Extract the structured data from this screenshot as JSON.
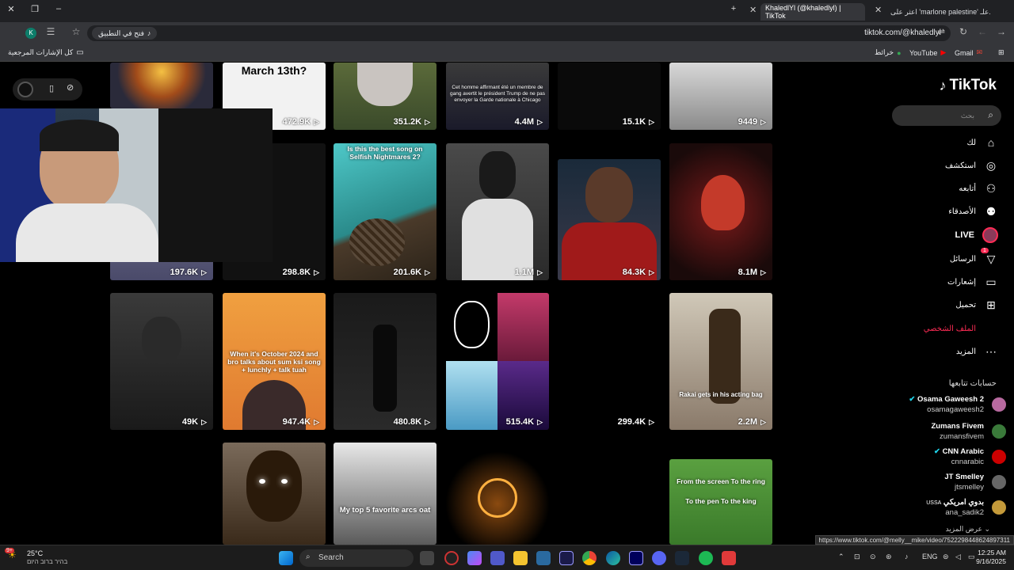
{
  "browser": {
    "tabs": [
      {
        "label": "KhaledlYl (@khaledlyl) | TikTok",
        "active": true
      },
      {
        "label": "اعثر على 'marlone palestine' علـ...",
        "active": false
      }
    ],
    "url": "tiktok.com/@khaledlyl",
    "open_in_app": "فتح في التطبيق",
    "bookmarks": {
      "all_bookmarks": "كل الإشارات المرجعية",
      "gmail": "Gmail",
      "youtube": "YouTube",
      "maps": "خرائط"
    },
    "profile_initial": "K"
  },
  "tiktok": {
    "logo": "TikTok",
    "search_placeholder": "بحث",
    "nav": [
      {
        "label": "لك",
        "icon": "home-icon"
      },
      {
        "label": "استكشف",
        "icon": "compass-icon"
      },
      {
        "label": "أتابعه",
        "icon": "following-icon"
      },
      {
        "label": "الأصدقاء",
        "icon": "friends-icon"
      },
      {
        "label": "LIVE",
        "icon": "live-icon"
      },
      {
        "label": "الرسائل",
        "icon": "send-icon",
        "badge": "1"
      },
      {
        "label": "إشعارات",
        "icon": "inbox-icon"
      },
      {
        "label": "تحميل",
        "icon": "upload-icon"
      },
      {
        "label": "الملف الشخصي",
        "icon": "profile-icon",
        "active": true
      },
      {
        "label": "المزيد",
        "icon": "more-icon"
      }
    ],
    "following_title": "حسابات تتابعها",
    "following": [
      {
        "name": "Osama Gaweesh 2",
        "handle": "osamagaweesh2",
        "verified": true,
        "color": "#b86aa0"
      },
      {
        "name": "Zumans Fivem",
        "handle": "zumansfivem",
        "verified": false,
        "color": "#3a7a3a"
      },
      {
        "name": "CNN Arabic",
        "handle": "cnnarabic",
        "verified": true,
        "color": "#cc0000"
      },
      {
        "name": "JT Smelley",
        "handle": "jtsmelley",
        "verified": false,
        "color": "#666666"
      },
      {
        "name": "بدوي امريكي",
        "prefix": "USSA",
        "handle": "ana_sadik2",
        "verified": false,
        "color": "#c49a3a"
      }
    ],
    "show_more": "عرض المزيد"
  },
  "videos": [
    {
      "views": "",
      "caption": ""
    },
    {
      "views": "472.9K",
      "caption": "March 13th?"
    },
    {
      "views": "351.2K",
      "caption": ""
    },
    {
      "views": "4.4M",
      "caption": "Cet homme affirmant été un membre de gang avertit le président Trump de ne pas envoyer la Garde nationale à Chicago"
    },
    {
      "views": "15.1K",
      "caption": ""
    },
    {
      "views": "9449",
      "caption": ""
    },
    {
      "views": "197.6K",
      "caption": ""
    },
    {
      "views": "298.8K",
      "caption": ""
    },
    {
      "views": "201.6K",
      "caption": "Is this the best song on Selfish Nightmares 2?"
    },
    {
      "views": "1.1M",
      "caption": ""
    },
    {
      "views": "84.3K",
      "caption": ""
    },
    {
      "views": "8.1M",
      "caption": ""
    },
    {
      "views": "49K",
      "caption": ""
    },
    {
      "views": "947.4K",
      "caption": "When it's October 2024 and bro talks about sum ksi song + lunchly + talk tuah"
    },
    {
      "views": "480.8K",
      "caption": ""
    },
    {
      "views": "515.4K",
      "caption": ""
    },
    {
      "views": "299.4K",
      "caption": ""
    },
    {
      "views": "2.2M",
      "caption": "Rakai gets in his acting bag"
    },
    {
      "views": "",
      "caption": ""
    },
    {
      "views": "",
      "caption": "My top 5 favorite arcs oat"
    },
    {
      "views": "",
      "caption": ""
    },
    {
      "views": "",
      "caption": "From the screen To the ring To the pen To the king"
    }
  ],
  "status_url": "https://www.tiktok.com/@melly__mike/video/7522298448624897311",
  "taskbar": {
    "weather_temp": "25°C",
    "weather_desc": "בהיר ברוב היום",
    "search_label": "Search",
    "lang": "ENG",
    "time": "12:25 AM",
    "date": "9/16/2025",
    "notif_badge": "9+"
  }
}
